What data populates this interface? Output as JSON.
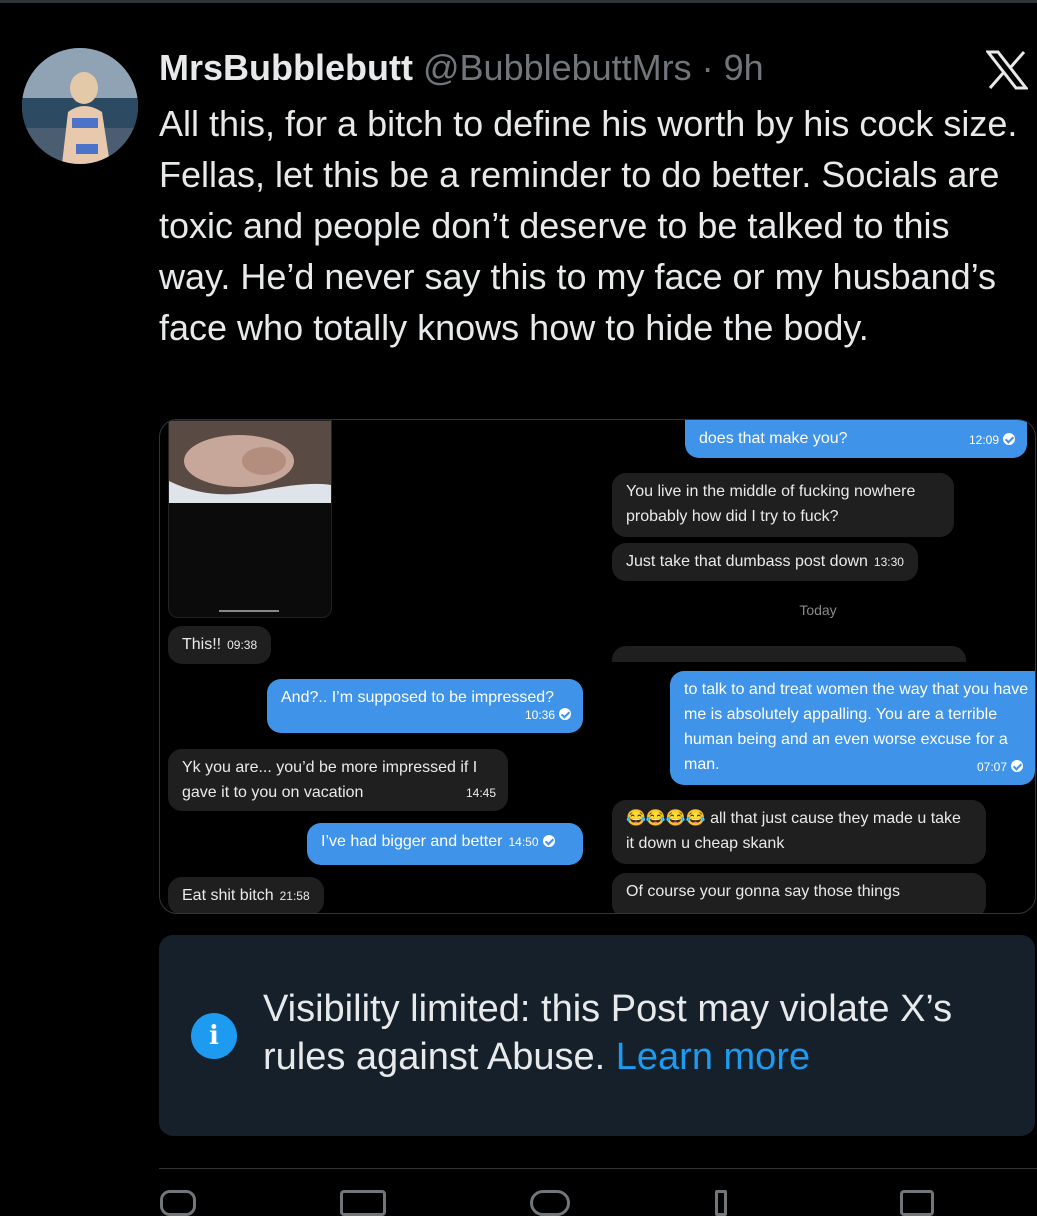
{
  "tweet": {
    "display_name": "MrsBubblebutt",
    "handle": "@BubblebuttMrs",
    "separator": " · ",
    "time": "9h",
    "text": "All this, for a bitch to define his worth by his cock size. Fellas, let this be a reminder to do better. Socials are toxic and people don’t deserve to be talked to this way. He’d never say this to my face or my husband’s face who totally knows how to hide the body."
  },
  "icons": {
    "brand": "x-logo-icon",
    "info": "info-icon"
  },
  "screenshot": {
    "left_chat": [
      {
        "text": "This!!",
        "time": "09:38"
      },
      {
        "text": "And?.. I’m supposed to be impressed?",
        "time": "10:36"
      },
      {
        "text": "Yk you are... you’d be more impressed if I gave it to you on vacation",
        "time": "14:45"
      },
      {
        "text": "I’ve had bigger and better",
        "time": "14:50"
      },
      {
        "text": "Eat shit bitch",
        "time": "21:58"
      }
    ],
    "right_chat": [
      {
        "text": "does that make you?",
        "time": "12:09"
      },
      {
        "text": "You live in the middle of fucking nowhere probably how did I try to fuck?"
      },
      {
        "text": "Just take that dumbass post down",
        "time": "13:30"
      },
      {
        "text": "Today"
      },
      {
        "text": "to talk to and treat women the way that you have me is absolutely appalling. You are a terrible human being and an even worse excuse for a man.",
        "time": "07:07"
      },
      {
        "text": "😂😂😂😂 all that just cause they made u take it down u cheap skank"
      },
      {
        "text": "Of course your gonna say those things"
      }
    ]
  },
  "notice": {
    "text": "Visibility limited: this Post may violate X’s rules against Abuse. ",
    "link": "Learn more"
  },
  "colors": {
    "link": "#1d9bf0",
    "sent_bubble": "#3f93e8",
    "notice_bg": "#16202b"
  }
}
